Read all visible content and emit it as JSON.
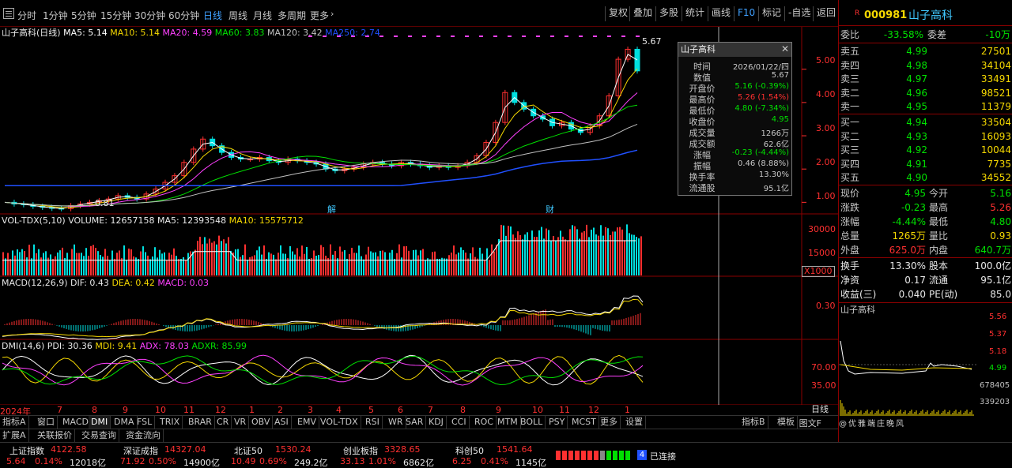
{
  "toolbar": {
    "periods": [
      "分时",
      "1分钟",
      "5分钟",
      "15分钟",
      "30分钟",
      "60分钟",
      "日线",
      "周线",
      "月线",
      "多周期",
      "更多"
    ],
    "active_period": "日线",
    "right_buttons": [
      "复权",
      "叠加",
      "多股",
      "统计",
      "画线",
      "F10",
      "标记",
      "-自选",
      "返回"
    ]
  },
  "main_pane": {
    "title": "山子高科(日线)",
    "ma": [
      {
        "label": "MA5: 5.14",
        "color": "#ffffff"
      },
      {
        "label": "MA10: 5.14",
        "color": "#f5d800"
      },
      {
        "label": "MA20: 4.59",
        "color": "#ff40ff"
      },
      {
        "label": "MA60: 3.83",
        "color": "#00e000"
      },
      {
        "label": "MA120: 3.42",
        "color": "#c0c0c0"
      },
      {
        "label": "MA250: 2.74",
        "color": "#2050ff"
      }
    ],
    "y_ticks": [
      "5.00",
      "4.00",
      "3.00",
      "2.00",
      "1.00"
    ],
    "high_label": "5.67",
    "low_label": "0.81",
    "event_marks": [
      "解",
      "财"
    ]
  },
  "vol_pane": {
    "title": "VOL-TDX(5,10)",
    "volume": "VOLUME: 12657158",
    "ma5": "MA5: 12393548",
    "ma10": "MA10: 15575712",
    "y_ticks": [
      "30000",
      "15000"
    ],
    "unit": "X1000"
  },
  "macd_pane": {
    "title": "MACD(12,26,9)",
    "dif": "DIF: 0.43",
    "dea": "DEA: 0.42",
    "macd": "MACD: 0.03",
    "y_ticks": [
      "0.30"
    ]
  },
  "dmi_pane": {
    "title": "DMI(14,6)",
    "pdi": "PDI: 30.36",
    "mdi": "MDI: 9.41",
    "adx": "ADX: 78.03",
    "adxr": "ADXR: 85.99",
    "y_ticks": [
      "70.00",
      "35.00"
    ]
  },
  "x_axis": {
    "labels": [
      "2024年",
      "7",
      "8",
      "9",
      "10",
      "11",
      "12",
      "1",
      "2",
      "3",
      "4",
      "5",
      "6",
      "7",
      "8",
      "9",
      "10",
      "11",
      "12",
      "1"
    ]
  },
  "tooltip": {
    "title": "山子高科",
    "rows": [
      {
        "label": "时间",
        "value": "2026/01/22/四",
        "color": "#c8c8c8"
      },
      {
        "label": "数值",
        "value": "5.67",
        "color": "#c8c8c8"
      },
      {
        "label": "开盘价",
        "value": "5.16 (-0.39%)",
        "color": "#00e000"
      },
      {
        "label": "最高价",
        "value": "5.26 (1.54%)",
        "color": "#ff3030"
      },
      {
        "label": "最低价",
        "value": "4.80 (-7.34%)",
        "color": "#00e000"
      },
      {
        "label": "收盘价",
        "value": "4.95",
        "color": "#00e000"
      },
      {
        "label": "成交量",
        "value": "1266万",
        "color": "#c8c8c8"
      },
      {
        "label": "成交额",
        "value": "62.6亿",
        "color": "#c8c8c8"
      },
      {
        "label": "涨幅",
        "value": "-0.23 (-4.44%)",
        "color": "#00e000"
      },
      {
        "label": "振幅",
        "value": "0.46 (8.88%)",
        "color": "#c8c8c8"
      },
      {
        "label": "换手率",
        "value": "13.30%",
        "color": "#c8c8c8"
      },
      {
        "label": "流通股",
        "value": "95.1亿",
        "color": "#c8c8c8"
      }
    ]
  },
  "quote": {
    "code": "000981",
    "name": "山子高科",
    "weibi_label": "委比",
    "weibi_value": "-33.58%",
    "weicha_label": "委差",
    "weicha_value": "-10万",
    "asks": [
      {
        "label": "卖五",
        "price": "4.99",
        "vol": "27501"
      },
      {
        "label": "卖四",
        "price": "4.98",
        "vol": "34104"
      },
      {
        "label": "卖三",
        "price": "4.97",
        "vol": "33491"
      },
      {
        "label": "卖二",
        "price": "4.96",
        "vol": "98521"
      },
      {
        "label": "卖一",
        "price": "4.95",
        "vol": "11379"
      }
    ],
    "bids": [
      {
        "label": "买一",
        "price": "4.94",
        "vol": "33504"
      },
      {
        "label": "买二",
        "price": "4.93",
        "vol": "16093"
      },
      {
        "label": "买三",
        "price": "4.92",
        "vol": "10044"
      },
      {
        "label": "买四",
        "price": "4.91",
        "vol": "7735"
      },
      {
        "label": "买五",
        "price": "4.90",
        "vol": "34552"
      }
    ],
    "stats": [
      {
        "l1": "现价",
        "v1": "4.95",
        "c1": "#00e000",
        "l2": "今开",
        "v2": "5.16",
        "c2": "#00e000"
      },
      {
        "l1": "涨跌",
        "v1": "-0.23",
        "c1": "#00e000",
        "l2": "最高",
        "v2": "5.26",
        "c2": "#ff3030"
      },
      {
        "l1": "涨幅",
        "v1": "-4.44%",
        "c1": "#00e000",
        "l2": "最低",
        "v2": "4.80",
        "c2": "#00e000"
      },
      {
        "l1": "总量",
        "v1": "1265万",
        "c1": "#f5d800",
        "l2": "量比",
        "v2": "0.93",
        "c2": "#f5d800"
      },
      {
        "l1": "外盘",
        "v1": "625.0万",
        "c1": "#ff3030",
        "l2": "内盘",
        "v2": "640.7万",
        "c2": "#00e000"
      }
    ],
    "stats2": [
      {
        "l1": "换手",
        "v1": "13.30%",
        "l2": "股本",
        "v2": "100.0亿"
      },
      {
        "l1": "净资",
        "v1": "0.17",
        "l2": "流通",
        "v2": "95.1亿"
      },
      {
        "l1": "收益(三)",
        "v1": "0.040",
        "l2": "PE(动)",
        "v2": "85.0"
      }
    ],
    "mini_title": "山子高科",
    "mini_ticks": [
      "5.56",
      "5.37",
      "5.18",
      "4.99",
      "678405",
      "339203"
    ]
  },
  "bottom_tabs": [
    "指标A",
    "窗口",
    "MACD",
    "DMI",
    "DMA",
    "FSL",
    "TRIX",
    "BRAR",
    "CR",
    "VR",
    "OBV",
    "ASI",
    "EMV",
    "VOL-TDX",
    "RSI",
    "WR",
    "SAR",
    "KDJ",
    "CCI",
    "ROC",
    "MTM",
    "BOLL",
    "PSY",
    "MCST",
    "更多",
    "设置"
  ],
  "bottom_tabs_selected": "DMI",
  "bottom_tabs_right": [
    "指标B",
    "模板"
  ],
  "sub_tabs": [
    "扩展A",
    "关联报价",
    "交易查询",
    "资金流向"
  ],
  "period_btn": "日线",
  "right_bottom": "图文F",
  "indices": [
    {
      "name": "上证指数",
      "value": "4122.58",
      "chg": "5.64",
      "pct": "0.14%",
      "amt": "12018亿",
      "color": "#ff3030"
    },
    {
      "name": "深证成指",
      "value": "14327.04",
      "chg": "71.92",
      "pct": "0.50%",
      "amt": "14900亿",
      "color": "#ff3030"
    },
    {
      "name": "北证50",
      "value": "1530.24",
      "chg": "10.49",
      "pct": "0.69%",
      "amt": "249.2亿",
      "color": "#ff3030"
    },
    {
      "name": "创业板指",
      "value": "3328.65",
      "chg": "33.13",
      "pct": "1.01%",
      "amt": "6862亿",
      "color": "#ff3030"
    },
    {
      "name": "科创50",
      "value": "1541.64",
      "chg": "6.25",
      "pct": "0.41%",
      "amt": "1145亿",
      "color": "#ff3030"
    }
  ],
  "connect_num": "4",
  "connect_text": "已连接",
  "watermark": "@优雅端庄晚风",
  "chart_data": {
    "type": "line",
    "series": [
      {
        "name": "MA5",
        "values": [
          5.14
        ]
      },
      {
        "name": "MA10",
        "values": [
          5.14
        ]
      },
      {
        "name": "MA20",
        "values": [
          4.59
        ]
      },
      {
        "name": "MA60",
        "values": [
          3.83
        ]
      },
      {
        "name": "MA120",
        "values": [
          3.42
        ]
      },
      {
        "name": "MA250",
        "values": [
          2.74
        ]
      }
    ],
    "ylim": [
      0.7,
      5.8
    ],
    "price_path": [
      1.0,
      0.95,
      0.93,
      0.88,
      0.85,
      0.82,
      0.81,
      0.9,
      0.95,
      1.0,
      1.05,
      1.1,
      1.2,
      1.15,
      1.1,
      1.25,
      1.4,
      1.6,
      1.8,
      2.2,
      2.6,
      2.9,
      2.7,
      2.5,
      2.35,
      2.3,
      2.3,
      2.35,
      2.25,
      2.2,
      2.3,
      2.25,
      2.2,
      2.15,
      2.0,
      1.95,
      2.0,
      2.05,
      2.15,
      2.2,
      2.15,
      2.1,
      2.2,
      2.15,
      2.1,
      2.05,
      2.1,
      2.05,
      2.1,
      2.2,
      2.4,
      2.8,
      3.4,
      4.3,
      4.0,
      3.8,
      3.6,
      3.5,
      3.3,
      3.4,
      3.2,
      3.1,
      3.3,
      3.6,
      4.2,
      5.3,
      5.6,
      4.95
    ]
  }
}
